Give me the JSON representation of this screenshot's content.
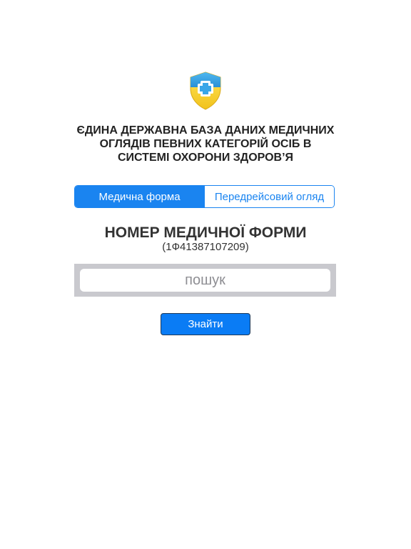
{
  "app": {
    "logo_icon": "shield-medical-cross-icon",
    "title_lines": [
      "ЄДИНА ДЕРЖАВНА БАЗА ДАНИХ МЕДИЧНИХ",
      "ОГЛЯДІВ ПЕВНИХ КАТЕГОРІЙ ОСІБ В",
      "СИСТЕМІ ОХОРОНИ ЗДОРОВ’Я"
    ]
  },
  "tabs": [
    {
      "label": "Медична форма",
      "selected": true
    },
    {
      "label": "Передрейсовий огляд",
      "selected": false
    }
  ],
  "form": {
    "heading": "НОМЕР МЕДИЧНОЇ ФОРМИ",
    "example": "(1Ф41387107209)"
  },
  "search": {
    "placeholder": "пошук",
    "value": ""
  },
  "actions": {
    "find_label": "Знайти"
  },
  "colors": {
    "accent": "#1a84f0",
    "button": "#0a7cf5",
    "shield_blue": "#3aa6e8",
    "shield_yellow": "#f6d22c",
    "search_bar_bg": "#c9c9ce"
  }
}
